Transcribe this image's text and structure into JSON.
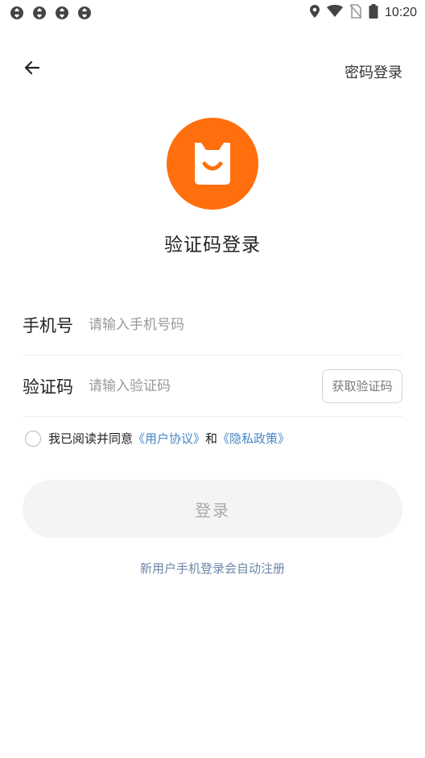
{
  "status_bar": {
    "time": "10:20",
    "notification_icons": [
      "app-notification-icon",
      "app-notification-icon",
      "app-notification-icon",
      "app-notification-icon"
    ],
    "right_icons": [
      "location-icon",
      "wifi-icon",
      "no-sim-icon",
      "battery-icon"
    ]
  },
  "nav": {
    "back_icon": "back-arrow-icon",
    "password_login_label": "密码登录"
  },
  "logo": {
    "color": "#ff6f0d"
  },
  "title": "验证码登录",
  "form": {
    "phone": {
      "label": "手机号",
      "placeholder": "请输入手机号码",
      "value": ""
    },
    "code": {
      "label": "验证码",
      "placeholder": "请输入验证码",
      "value": "",
      "get_code_label": "获取验证码"
    }
  },
  "agreement": {
    "checked": false,
    "prefix": "我已阅读并同意",
    "user_agreement": "《用户协议》",
    "conjunction": "和",
    "privacy_policy": "《隐私政策》",
    "link_color": "#4a86c5"
  },
  "login_button": {
    "label": "登录"
  },
  "footer_note": "新用户手机登录会自动注册"
}
